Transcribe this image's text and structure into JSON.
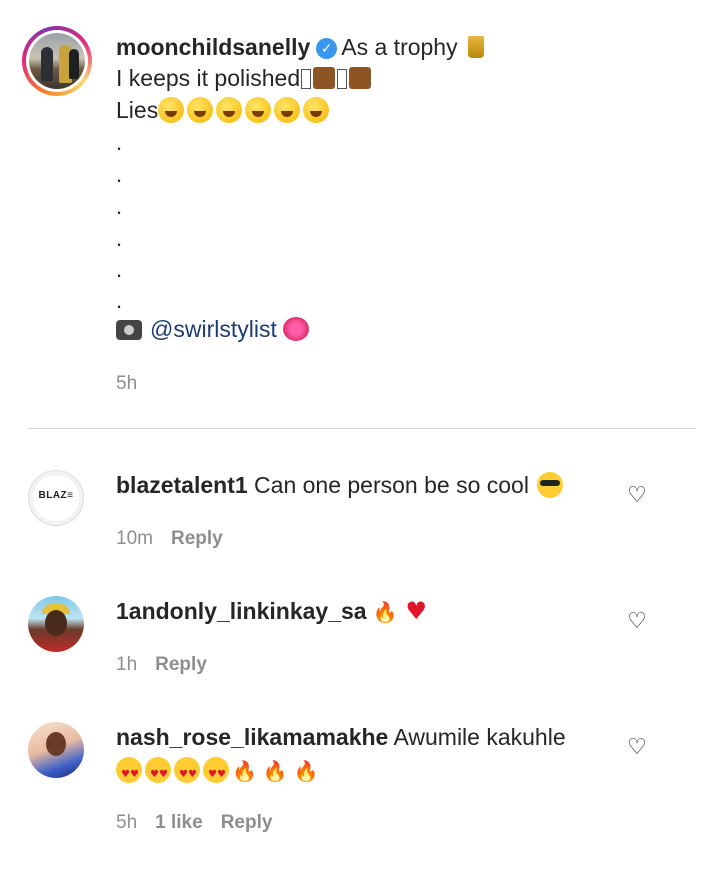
{
  "caption": {
    "username": "moonchildsanelly",
    "line1_text": "As a trophy",
    "line2_text": "I keeps it polished",
    "line3_text": "Lies",
    "dots": [
      ".",
      ".",
      ".",
      ".",
      ".",
      "."
    ],
    "mention": "@swirlstylist",
    "time": "5h"
  },
  "comments": [
    {
      "username": "blazetalent1",
      "text": "Can one person be so cool",
      "time": "10m",
      "reply_label": "Reply",
      "avatar_text": "BLAZ≡"
    },
    {
      "username": "1andonly_linkinkay_sa",
      "text": "",
      "time": "1h",
      "reply_label": "Reply"
    },
    {
      "username": "nash_rose_likamamakhe",
      "text": "Awumile kakuhle",
      "time": "5h",
      "likes": "1 like",
      "reply_label": "Reply"
    }
  ],
  "icons": {
    "like": "heart-outline-icon",
    "verified": "verified-badge-icon"
  },
  "colors": {
    "text": "#262626",
    "meta": "#8e8e8e",
    "verified": "#3897f0",
    "mention": "#1e3c72",
    "divider": "#dbdbdb"
  }
}
